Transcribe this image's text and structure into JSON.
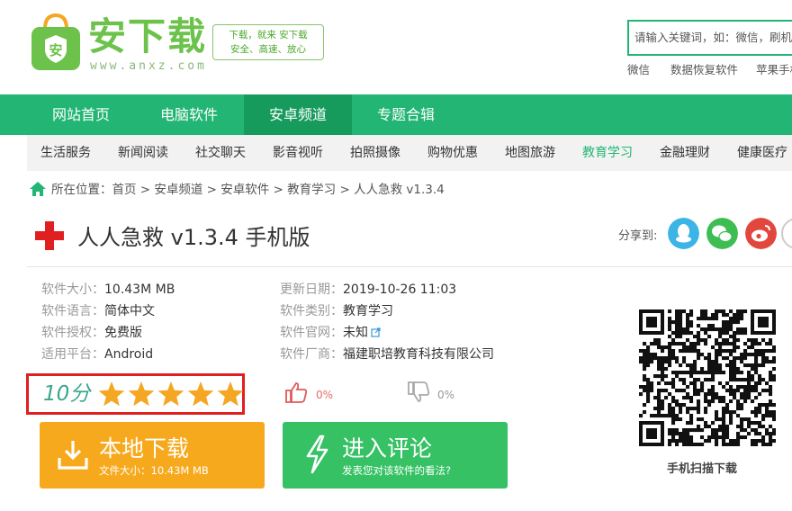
{
  "header": {
    "logo_text": "安下载",
    "logo_url": "www.anxz.com",
    "slogan_line1": "下载，就来 安下载",
    "slogan_line2": "安全、高速、放心",
    "search_placeholder": "请输入关键词，如：微信，刷机精灵",
    "hot_words": [
      "微信",
      "数据恢复软件",
      "苹果手机"
    ]
  },
  "main_nav": [
    "网站首页",
    "电脑软件",
    "安卓频道",
    "专题合辑"
  ],
  "main_nav_active": "安卓频道",
  "sub_nav": [
    "生活服务",
    "新闻阅读",
    "社交聊天",
    "影音视听",
    "拍照摄像",
    "购物优惠",
    "地图旅游",
    "教育学习",
    "金融理财",
    "健康医疗"
  ],
  "sub_nav_active": "教育学习",
  "breadcrumb": {
    "label": "所在位置：",
    "text": "首页 > 安卓频道 > 安卓软件 > 教育学习 > 人人急救 v1.3.4"
  },
  "title": "人人急救 v1.3.4 手机版",
  "share_label": "分享到:",
  "info_left": [
    {
      "k": "软件大小：",
      "v": "10.43M MB"
    },
    {
      "k": "软件语言：",
      "v": "简体中文"
    },
    {
      "k": "软件授权：",
      "v": "免费版"
    },
    {
      "k": "适用平台：",
      "v": "Android"
    }
  ],
  "info_right": [
    {
      "k": "更新日期：",
      "v": "2019-10-26 11:03"
    },
    {
      "k": "软件类别：",
      "v": "教育学习"
    },
    {
      "k": "软件官网：",
      "v": "未知"
    },
    {
      "k": "软件厂商：",
      "v": "福建职培教育科技有限公司"
    }
  ],
  "rating": {
    "score": "10分",
    "stars": 5,
    "max": 5
  },
  "votes": {
    "up": "0%",
    "down": "0%"
  },
  "download_button": {
    "label": "本地下载",
    "sub": "文件大小：10.43M MB"
  },
  "comment_button": {
    "label": "进入评论",
    "sub": "发表您对该软件的看法?"
  },
  "qr_caption": "手机扫描下载",
  "colors": {
    "brand": "#22b573",
    "nav_active": "#169b5d",
    "download": "#f7a91d",
    "comment": "#35c164",
    "highlight": "#e02020"
  }
}
